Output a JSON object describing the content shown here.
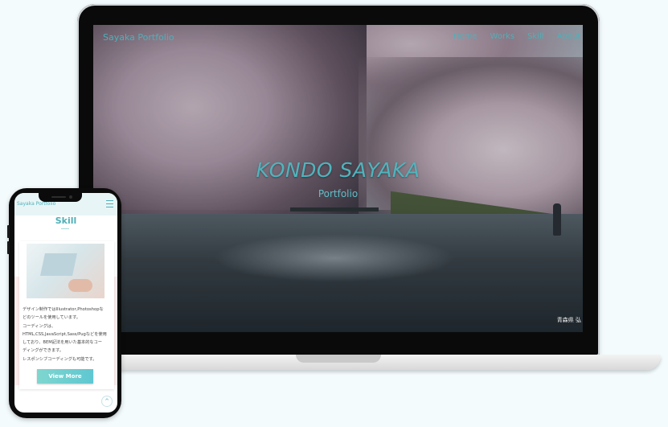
{
  "laptop_site": {
    "logo": "Sayaka Portfolio",
    "nav": [
      "Home",
      "Works",
      "Skill",
      "About"
    ],
    "hero_title": "KONDO SAYAKA",
    "hero_subtitle": "Portfolio",
    "photo_caption": "青森県 弘"
  },
  "phone_site": {
    "logo": "Sayaka Portfolio",
    "section_title": "Skill",
    "description_lines": [
      "デザイン制作ではIllustrator,Photoshopな",
      "どのツールを使用しています。",
      "コーディングは、",
      "HTML,CSS,JavaScript,Sass/Pugなどを使用",
      "しており、BEM記法を用いた基本的なコー",
      "ディングができます。",
      "レスポンシブコーディングも可能です。"
    ],
    "button_label": "View More",
    "back_to_top": "^"
  },
  "icons": {
    "menu": "hamburger-icon",
    "back_to_top": "chevron-up-icon"
  },
  "colors": {
    "accent": "#4fb0b9",
    "button_gradient_start": "#7fd6cf",
    "button_gradient_end": "#5fc7d1",
    "page_background": "#f4fbfd"
  }
}
